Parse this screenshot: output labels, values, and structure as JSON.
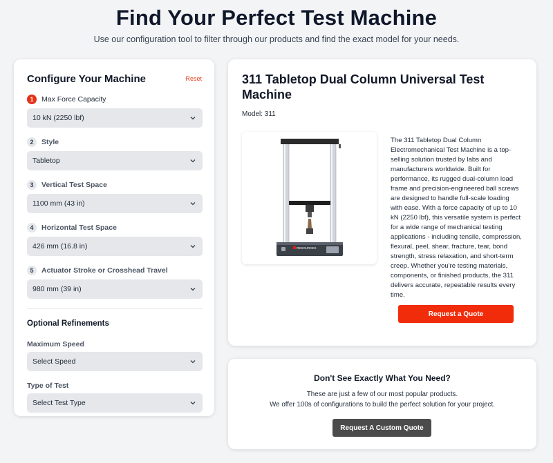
{
  "hero": {
    "title": "Find Your Perfect Test Machine",
    "subtitle": "Use our configuration tool to filter through our products and find the exact model for your needs."
  },
  "config": {
    "title": "Configure Your Machine",
    "reset_label": "Reset",
    "fields": [
      {
        "num": "1",
        "label": "Max Force Capacity",
        "value": "10 kN (2250 lbf)"
      },
      {
        "num": "2",
        "label": "Style",
        "value": "Tabletop"
      },
      {
        "num": "3",
        "label": "Vertical Test Space",
        "value": "1100 mm (43 in)"
      },
      {
        "num": "4",
        "label": "Horizontal Test Space",
        "value": "426 mm (16.8 in)"
      },
      {
        "num": "5",
        "label": "Actuator Stroke or Crosshead Travel",
        "value": "980 mm (39 in)"
      }
    ],
    "optional": {
      "title": "Optional Refinements",
      "speed_label": "Maximum Speed",
      "speed_value": "Select Speed",
      "type_label": "Type of Test",
      "type_value": "Select Test Type"
    }
  },
  "product": {
    "title": "311 Tabletop Dual Column Universal Test Machine",
    "model": "Model: 311",
    "brand_text": "RESOURCES",
    "description": "The 311 Tabletop Dual Column Electromechanical Test Machine is a top-selling solution trusted by labs and manufacturers worldwide. Built for performance, its rugged dual-column load frame and precision-engineered ball screws are designed to handle full-scale loading with ease. With a force capacity of up to 10 kN (2250 lbf), this versatile system is perfect for a wide range of mechanical testing applications - including tensile, compression, flexural, peel, shear, fracture, tear, bond strength, stress relaxation, and short-term creep. Whether you're testing materials, components, or finished products, the 311 delivers accurate, repeatable results every time.",
    "quote_label": "Request a Quote"
  },
  "custom": {
    "title": "Don't See Exactly What You Need?",
    "line1": "These are just a few of our most popular products.",
    "line2": "We offer 100s of configurations to build the perfect solution for your project.",
    "button_label": "Request A Custom Quote"
  },
  "colors": {
    "accent": "#f12c0a",
    "step_active": "#e53015",
    "dark_button": "#4b4b4b",
    "background": "#f3f4f6"
  }
}
